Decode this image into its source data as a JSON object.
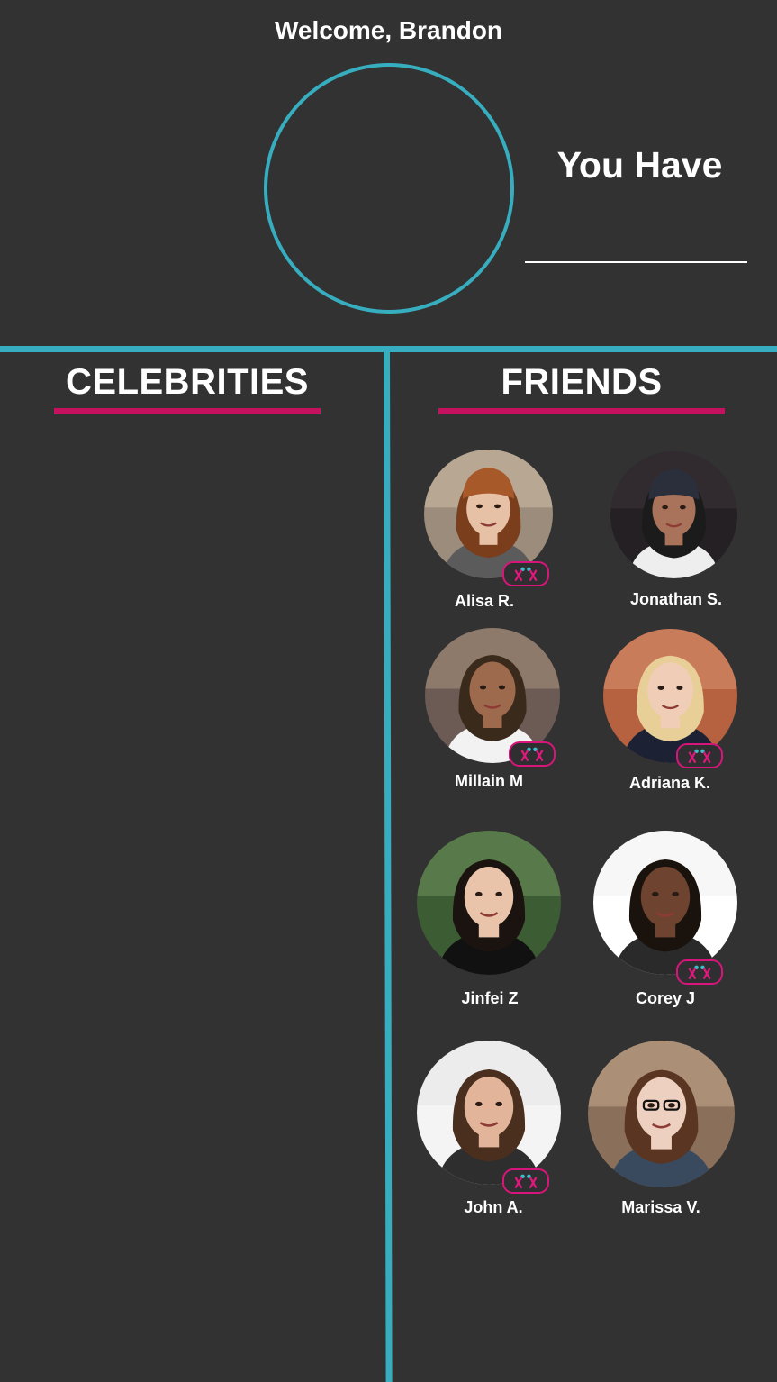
{
  "header": {
    "welcome": "Welcome, Brandon",
    "you_have": "You Have"
  },
  "celebrities": {
    "title": "CELEBRITIES",
    "items": []
  },
  "friends": {
    "title": "FRIENDS",
    "items": [
      {
        "name": "Alisa R.",
        "app_badge": true
      },
      {
        "name": "Jonathan S.",
        "app_badge": false
      },
      {
        "name": "Millain M",
        "app_badge": true
      },
      {
        "name": "Adriana K.",
        "app_badge": true
      },
      {
        "name": "Jinfei Z",
        "app_badge": false
      },
      {
        "name": "Corey J",
        "app_badge": true
      },
      {
        "name": "John A.",
        "app_badge": true
      },
      {
        "name": "Marissa V.",
        "app_badge": false
      }
    ]
  },
  "colors": {
    "background": "#333233",
    "accent_teal": "#36aebf",
    "accent_magenta": "#c6115f"
  },
  "icons": {
    "app_badge": "people-logo-icon"
  }
}
